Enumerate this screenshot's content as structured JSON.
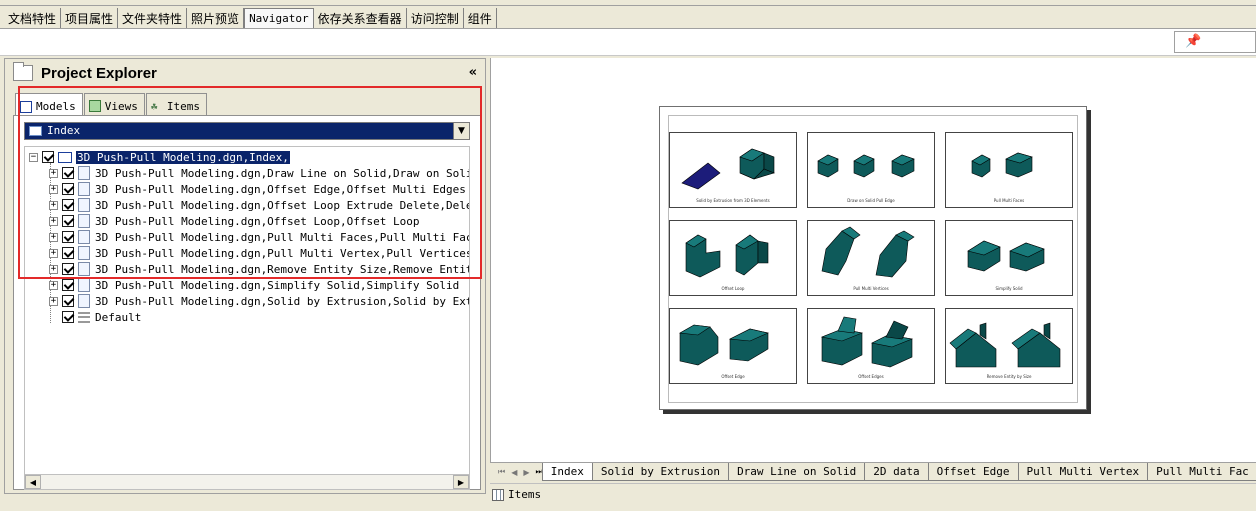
{
  "top_tabs": [
    "文档特性",
    "项目属性",
    "文件夹特性",
    "照片预览",
    "Navigator",
    "依存关系查看器",
    "访问控制",
    "组件"
  ],
  "active_top_tab": "Navigator",
  "panel": {
    "title": "Project Explorer",
    "collapse_glyph": "«",
    "tabs": [
      "Models",
      "Views",
      "Items"
    ],
    "dropdown_value": "Index"
  },
  "tree": {
    "root": "3D Push-Pull Modeling.dgn,Index,",
    "children": [
      "3D Push-Pull Modeling.dgn,Draw Line on Solid,Draw on Solid",
      "3D Push-Pull Modeling.dgn,Offset Edge,Offset Multi Edges",
      "3D Push-Pull Modeling.dgn,Offset Loop Extrude Delete,Delete E",
      "3D Push-Pull Modeling.dgn,Offset Loop,Offset Loop",
      "3D Push-Pull Modeling.dgn,Pull Multi Faces,Pull Multi Faces",
      "3D Push-Pull Modeling.dgn,Pull Multi Vertex,Pull Vertices",
      "3D Push-Pull Modeling.dgn,Remove Entity Size,Remove Entity by",
      "3D Push-Pull Modeling.dgn,Simplify Solid,Simplify Solid",
      "3D Push-Pull Modeling.dgn,Solid by Extrusion,Solid by Extrusi"
    ],
    "default_item": "Default"
  },
  "sheet_captions": [
    "Solid by Extrusion from 3D Elements",
    "Draw on Solid Pull Edge",
    "Pull Multi Faces",
    "Offset Loop",
    "Pull Multi Vertices",
    "Simplify Solid",
    "Offset Edge",
    "Offset Edges",
    "Remove Entity by Size"
  ],
  "bottom_tabs": [
    "Index",
    "Solid by Extrusion",
    "Draw Line on Solid",
    "2D data",
    "Offset Edge",
    "Pull Multi Vertex",
    "Pull Multi Fac"
  ],
  "active_bottom_tab": "Index",
  "status_label": "Items",
  "colors": {
    "selection": "#0a246a",
    "highlight_border": "#e32a2a",
    "solid_fill": "#0e5a5a"
  }
}
